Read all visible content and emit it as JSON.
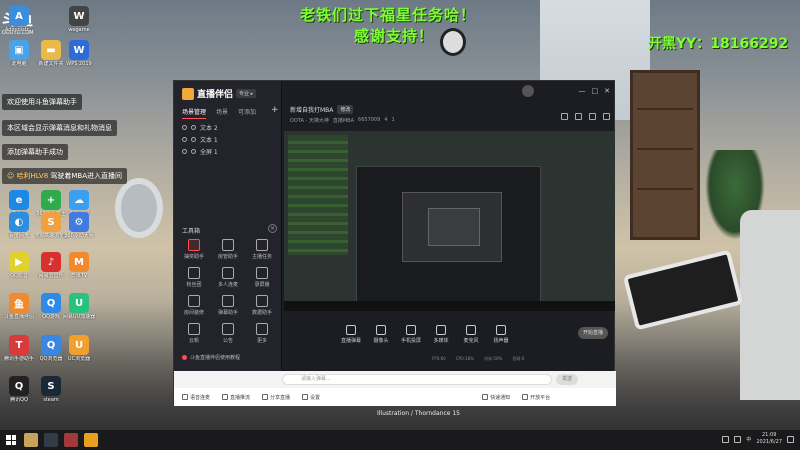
{
  "overlay": {
    "banner_line1": "老铁们过下福星任务哈！",
    "banner_line2": "感谢支持！",
    "yy_contact": "开黑YY：18166292",
    "logo_big": "斗鱼",
    "logo_small": "DOUYU.COM"
  },
  "desktop_icons": [
    {
      "label": "Administr...",
      "color": "#3c8dde",
      "glyph": "A"
    },
    {
      "label": "此电脑",
      "color": "#4aa3e8",
      "glyph": "▣"
    },
    {
      "label": "新建文件夹",
      "color": "#e9b949",
      "glyph": "▬"
    },
    {
      "label": "WPS 2019",
      "color": "#2d6bd8",
      "glyph": "W"
    },
    {
      "label": "wegame",
      "color": "#444444",
      "glyph": "W"
    },
    {
      "label": "Edge",
      "color": "#1e88e5",
      "glyph": "e"
    },
    {
      "label": "360安全卫士",
      "color": "#2eab4a",
      "glyph": "+"
    },
    {
      "label": "天气预报",
      "color": "#3a9ff0",
      "glyph": "☁"
    },
    {
      "label": "百度网盘",
      "color": "#2f8de0",
      "glyph": "◐"
    },
    {
      "label": "搜狗高速浏览器",
      "color": "#f0a040",
      "glyph": "S"
    },
    {
      "label": "360驱动大师",
      "color": "#3f7be0",
      "glyph": "⚙"
    },
    {
      "label": "QQ影音",
      "color": "#e0d030",
      "glyph": "▶"
    },
    {
      "label": "网易云音乐",
      "color": "#d8312d",
      "glyph": "♪"
    },
    {
      "label": "芒果TV",
      "color": "#f08a2c",
      "glyph": "M"
    },
    {
      "label": "斗鱼直播伴侣",
      "color": "#f08a2c",
      "glyph": "鱼"
    },
    {
      "label": "QQ游戏",
      "color": "#2e8ae6",
      "glyph": "Q"
    },
    {
      "label": "网易UU加速器",
      "color": "#2ac07e",
      "glyph": "U"
    },
    {
      "label": "腾讯手游助手",
      "color": "#d73b3b",
      "glyph": "T"
    },
    {
      "label": "QQ浏览器",
      "color": "#3b86e0",
      "glyph": "Q"
    },
    {
      "label": "UC浏览器",
      "color": "#f0a030",
      "glyph": "U"
    },
    {
      "label": "腾讯QQ",
      "color": "#222222",
      "glyph": "Q"
    },
    {
      "label": "steam",
      "color": "#1b2838",
      "glyph": "S"
    }
  ],
  "chat_messages": [
    {
      "text": "欢迎使用斗鱼弹幕助手"
    },
    {
      "text": "本区域会显示弹幕消息和礼物消息"
    },
    {
      "text": "添加弹幕助手成功"
    },
    {
      "user": "☺ 哈利HLV8 ",
      "text": "驾驶着MBA进入直播间"
    }
  ],
  "app": {
    "brand": "直播伴侣",
    "version": "专业 ▸",
    "scene_tabs": [
      "场景管理",
      "场景",
      "可添加"
    ],
    "add_scene": "+",
    "sources": [
      "文本 2",
      "文本 1",
      "全屏 1"
    ],
    "tools_title": "工具箱",
    "tools_close": "×",
    "tools": [
      {
        "label": "抽奖助手",
        "highlight": true
      },
      {
        "label": "房管助手",
        "highlight": false
      },
      {
        "label": "主播任务",
        "highlight": false
      },
      {
        "label": "粉丝团",
        "highlight": false
      },
      {
        "label": "多人连麦",
        "highlight": false
      },
      {
        "label": "录屏播",
        "highlight": false
      },
      {
        "label": "房间装修",
        "highlight": false
      },
      {
        "label": "弹幕助手",
        "highlight": false
      },
      {
        "label": "数据助手",
        "highlight": false
      },
      {
        "label": "云帆",
        "highlight": false
      },
      {
        "label": "公告",
        "highlight": false
      },
      {
        "label": "更多",
        "highlight": false
      }
    ],
    "left_footer": "斗鱼直播伴侣使用教程",
    "room_title": "新增自我打MBA",
    "room_tag": "修改",
    "room_sub": [
      "DOTA - 天梯大神",
      "直播MBA",
      "6657009",
      "4",
      "1"
    ],
    "window_buttons": [
      "—",
      "□",
      "✕"
    ],
    "bottom_tools": [
      "直播弹幕",
      "摄像头",
      "手机投屏",
      "多媒体",
      "麦克风",
      "扬声器"
    ],
    "live_button": "开始直播",
    "status_items": [
      "FPS:60",
      "CPU:18%",
      "内存:50%",
      "丢帧:0"
    ],
    "chat_placeholder": "请输入弹幕...",
    "send_label": "发送",
    "footer_items": [
      "语音连麦",
      "直播推流",
      "分享直播",
      "设置"
    ],
    "footer_extra": [
      "快速通知",
      "开放平台"
    ]
  },
  "wallpaper_credit": "Illustration / Thorndance 15",
  "taskbar": {
    "apps": [
      {
        "color": "#c8a35a"
      },
      {
        "color": "#333b47"
      },
      {
        "color": "#a33a3a"
      },
      {
        "color": "#e8a020"
      }
    ],
    "time": "21:09",
    "date": "2021/6/27",
    "ime": "中"
  }
}
